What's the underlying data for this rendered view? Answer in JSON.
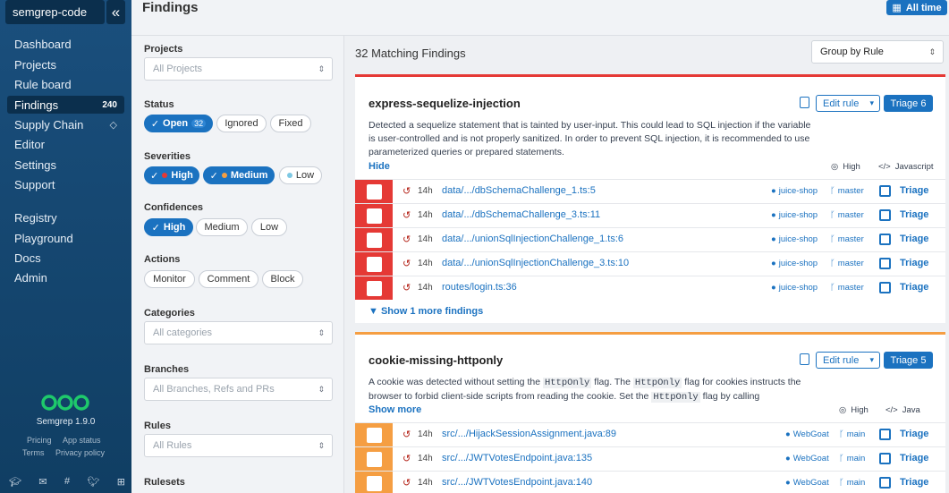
{
  "sidebar": {
    "org": "semgrep-code",
    "collapse_icon": "«",
    "items": [
      {
        "label": "Dashboard"
      },
      {
        "label": "Projects"
      },
      {
        "label": "Rule board"
      },
      {
        "label": "Findings",
        "badge": "240"
      },
      {
        "label": "Supply Chain"
      },
      {
        "label": "Editor"
      },
      {
        "label": "Settings"
      },
      {
        "label": "Support"
      },
      {
        "label": "Registry"
      },
      {
        "label": "Playground"
      },
      {
        "label": "Docs"
      },
      {
        "label": "Admin"
      }
    ],
    "version": "Semgrep 1.9.0",
    "footer_links": [
      "Pricing",
      "App status",
      "Terms",
      "Privacy policy"
    ],
    "social_icons": [
      "graduation-cap-icon",
      "mail-icon",
      "slack-icon",
      "twitter-icon",
      "gift-icon"
    ],
    "logo_color": "#1ec96b"
  },
  "header": {
    "title": "Findings",
    "time_filter": "All time"
  },
  "filters": {
    "projects": {
      "label": "Projects",
      "placeholder": "All Projects"
    },
    "status": {
      "label": "Status",
      "options": [
        {
          "label": "Open",
          "count": "32",
          "selected": true
        },
        {
          "label": "Ignored"
        },
        {
          "label": "Fixed"
        }
      ]
    },
    "severities": {
      "label": "Severities",
      "options": [
        {
          "label": "High",
          "selected": true,
          "color": "#e53935"
        },
        {
          "label": "Medium",
          "selected": true,
          "color": "#f59e42"
        },
        {
          "label": "Low",
          "selected": false,
          "color": "#7ec8e3"
        }
      ]
    },
    "confidences": {
      "label": "Confidences",
      "options": [
        {
          "label": "High",
          "selected": true
        },
        {
          "label": "Medium"
        },
        {
          "label": "Low"
        }
      ]
    },
    "actions": {
      "label": "Actions",
      "options": [
        "Monitor",
        "Comment",
        "Block"
      ]
    },
    "categories": {
      "label": "Categories",
      "placeholder": "All categories"
    },
    "branches": {
      "label": "Branches",
      "placeholder": "All Branches, Refs and PRs"
    },
    "rules": {
      "label": "Rules",
      "placeholder": "All Rules"
    },
    "rulesets": {
      "label": "Rulesets"
    }
  },
  "main": {
    "matching": "32 Matching Findings",
    "group_by": "Group by Rule",
    "cards": [
      {
        "title": "express-sequelize-injection",
        "severity_color": "#e53935",
        "edit_rule": "Edit rule",
        "triage": "Triage 6",
        "description": "Detected a sequelize statement that is tainted by user-input. This could lead to SQL injection if the variable is user-controlled and is not properly sanitized. In order to prevent SQL injection, it is recommended to use parameterized queries or prepared statements.",
        "toggle": "Hide",
        "severity": "High",
        "language": "Javascript",
        "findings": [
          {
            "age": "14h",
            "path": "data/.../dbSchemaChallenge_1.ts:5",
            "repo": "juice-shop",
            "branch": "master",
            "action": "Triage"
          },
          {
            "age": "14h",
            "path": "data/.../dbSchemaChallenge_3.ts:11",
            "repo": "juice-shop",
            "branch": "master",
            "action": "Triage"
          },
          {
            "age": "14h",
            "path": "data/.../unionSqlInjectionChallenge_1.ts:6",
            "repo": "juice-shop",
            "branch": "master",
            "action": "Triage"
          },
          {
            "age": "14h",
            "path": "data/.../unionSqlInjectionChallenge_3.ts:10",
            "repo": "juice-shop",
            "branch": "master",
            "action": "Triage"
          },
          {
            "age": "14h",
            "path": "routes/login.ts:36",
            "repo": "juice-shop",
            "branch": "master",
            "action": "Triage"
          }
        ],
        "show_more": "Show 1 more findings"
      },
      {
        "title": "cookie-missing-httponly",
        "severity_color": "#f59e42",
        "edit_rule": "Edit rule",
        "triage": "Triage 5",
        "description_parts": [
          "A cookie was detected without setting the ",
          "HttpOnly",
          " flag. The ",
          "HttpOnly",
          " flag for cookies instructs the browser to forbid client-side scripts from reading the cookie. Set the ",
          "HttpOnly",
          " flag by calling"
        ],
        "toggle": "Show more",
        "severity": "High",
        "language": "Java",
        "findings": [
          {
            "age": "14h",
            "path": "src/.../HijackSessionAssignment.java:89",
            "repo": "WebGoat",
            "branch": "main",
            "action": "Triage"
          },
          {
            "age": "14h",
            "path": "src/.../JWTVotesEndpoint.java:135",
            "repo": "WebGoat",
            "branch": "main",
            "action": "Triage"
          },
          {
            "age": "14h",
            "path": "src/.../JWTVotesEndpoint.java:140",
            "repo": "WebGoat",
            "branch": "main",
            "action": "Triage"
          }
        ]
      }
    ]
  }
}
